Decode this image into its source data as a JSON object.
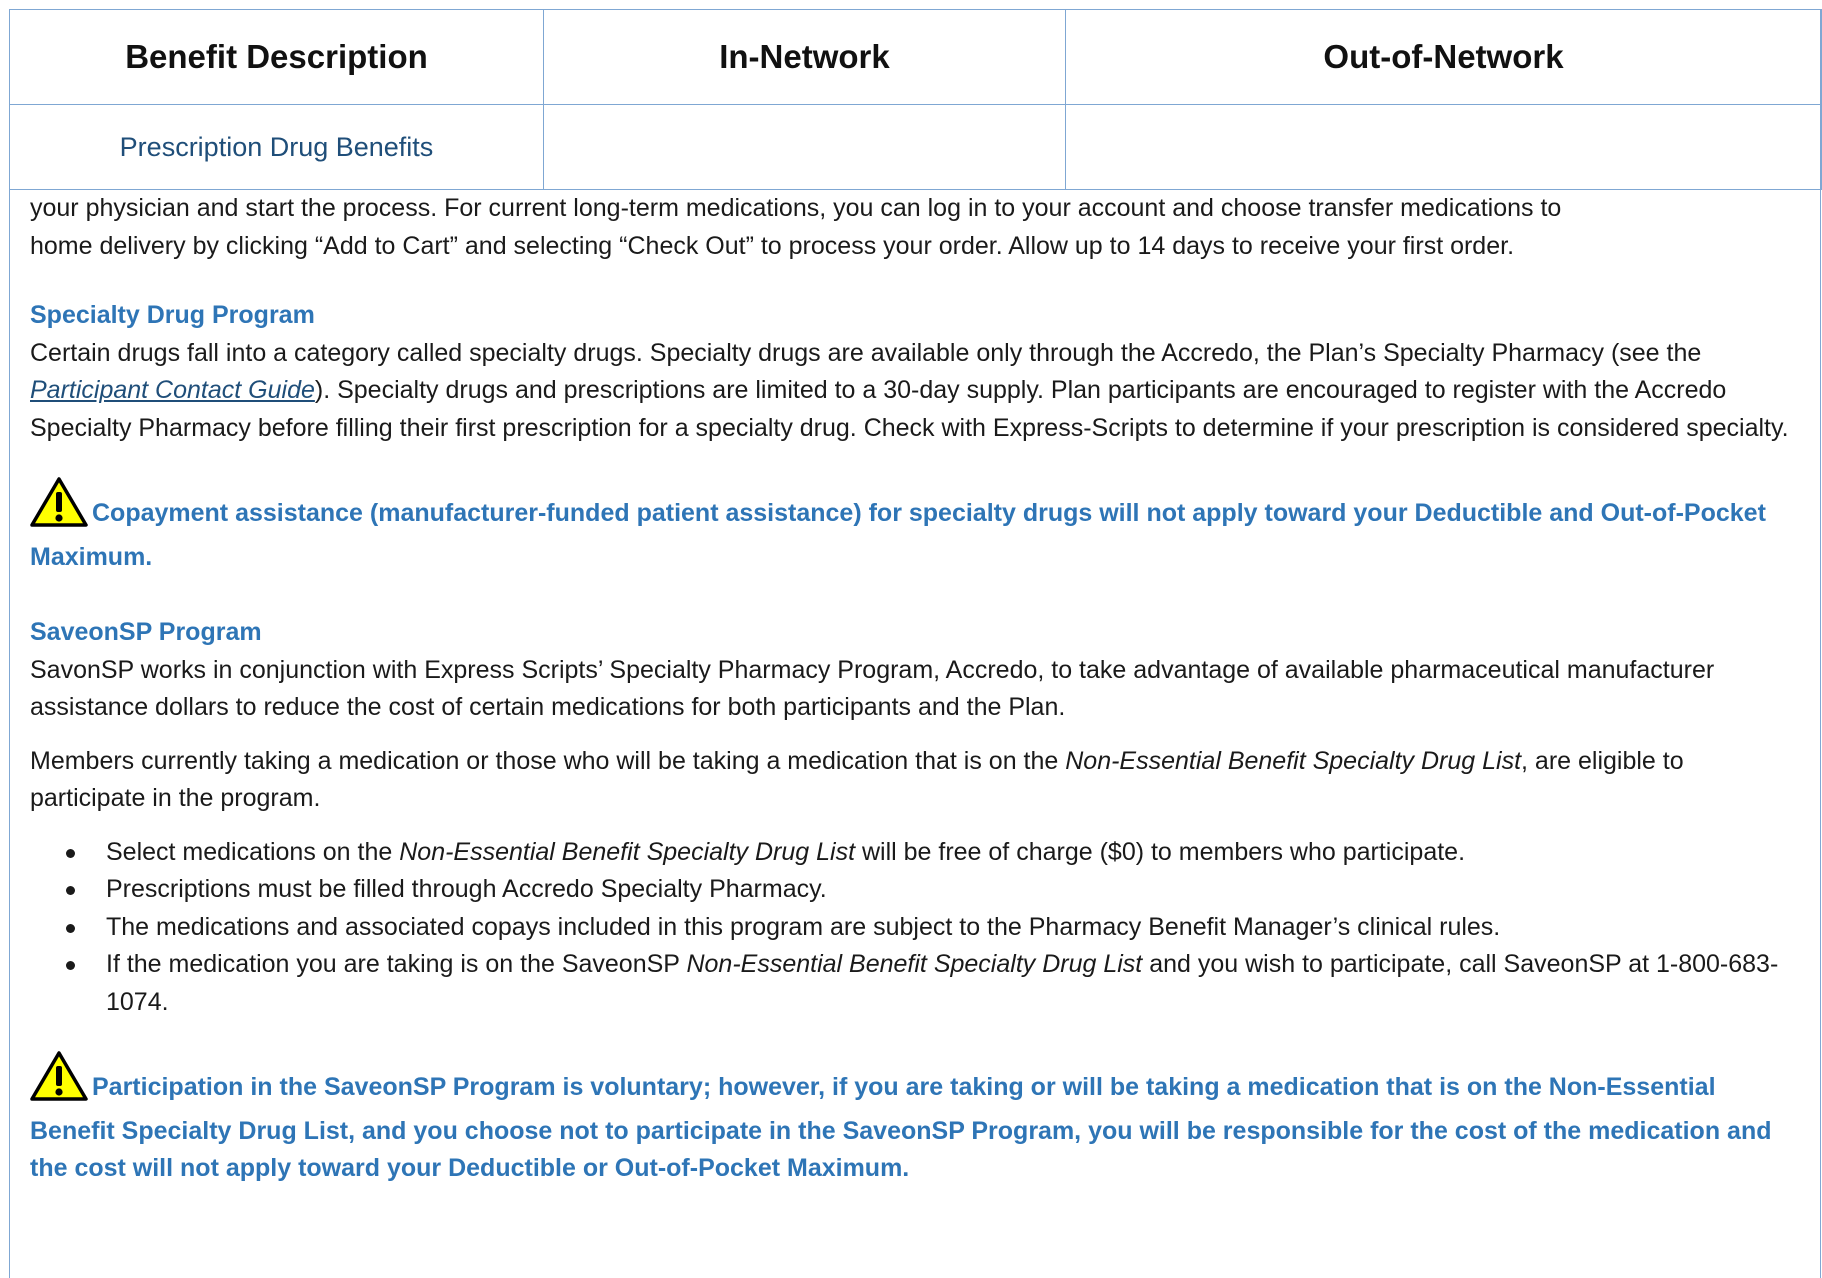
{
  "table": {
    "headers": [
      "Benefit Description",
      "In-Network",
      "Out-of-Network"
    ],
    "category": "Prescription Drug Benefits"
  },
  "intro": {
    "line1": "your physician and start the process. For current long-term medications, you can log in to your account and choose transfer medications to",
    "line2": "home delivery by clicking “Add to Cart” and selecting “Check Out” to process your order. Allow up to 14 days to receive your first order."
  },
  "specialty": {
    "heading": "Specialty Drug Program",
    "text_a": "Certain drugs fall into a category called specialty drugs. Specialty drugs are available only through the Accredo, the Plan’s Specialty Pharmacy (see the ",
    "link": "Participant Contact Guide",
    "text_b": "). Specialty drugs and prescriptions are limited to a 30-day supply. Plan participants are encouraged to register with the Accredo Specialty Pharmacy before filling their first prescription for a specialty drug. Check with Express-Scripts to determine if your prescription is considered specialty."
  },
  "warning1": "Copayment assistance (manufacturer-funded patient assistance) for specialty drugs will not apply toward your Deductible and Out-of-Pocket Maximum.",
  "saveon": {
    "heading": "SaveonSP Program",
    "para1": "SavonSP works in conjunction with Express Scripts’ Specialty Pharmacy Program, Accredo, to take advantage of available pharmaceutical manufacturer assistance dollars to reduce the cost of certain medications for both participants and the Plan.",
    "para2_a": "Members currently taking a medication or those who will be taking a medication that is on the ",
    "para2_em": "Non-Essential Benefit Specialty Drug List",
    "para2_b": ", are eligible to participate in the program.",
    "bullet1_a": "Select medications on the ",
    "bullet1_em": "Non-Essential Benefit Specialty Drug List",
    "bullet1_b": " will be free of charge ($0) to members who participate.",
    "bullet2": "Prescriptions must be filled through Accredo Specialty Pharmacy.",
    "bullet3": "The medications and associated copays included in this program are subject to the Pharmacy Benefit Manager’s clinical rules.",
    "bullet4_a": "If the medication you are taking is on the SaveonSP ",
    "bullet4_em": "Non-Essential Benefit Specialty Drug List",
    "bullet4_b": " and you wish to participate, call SaveonSP at 1-800-683-1074."
  },
  "warning2": "Participation in the SaveonSP Program is voluntary; however, if you are taking or will be taking a medication that is on the Non-Essential Benefit Specialty Drug List, and you choose not to participate in the SaveonSP Program, you will be responsible for the cost of the medication and the cost will not apply toward your Deductible or Out-of-Pocket Maximum.",
  "icons": {
    "warning": "warning-triangle-icon"
  },
  "colors": {
    "accent": "#2e75b6",
    "border": "#7fa7d3",
    "link": "#1f4e79",
    "warning_fill": "#ffff00"
  }
}
